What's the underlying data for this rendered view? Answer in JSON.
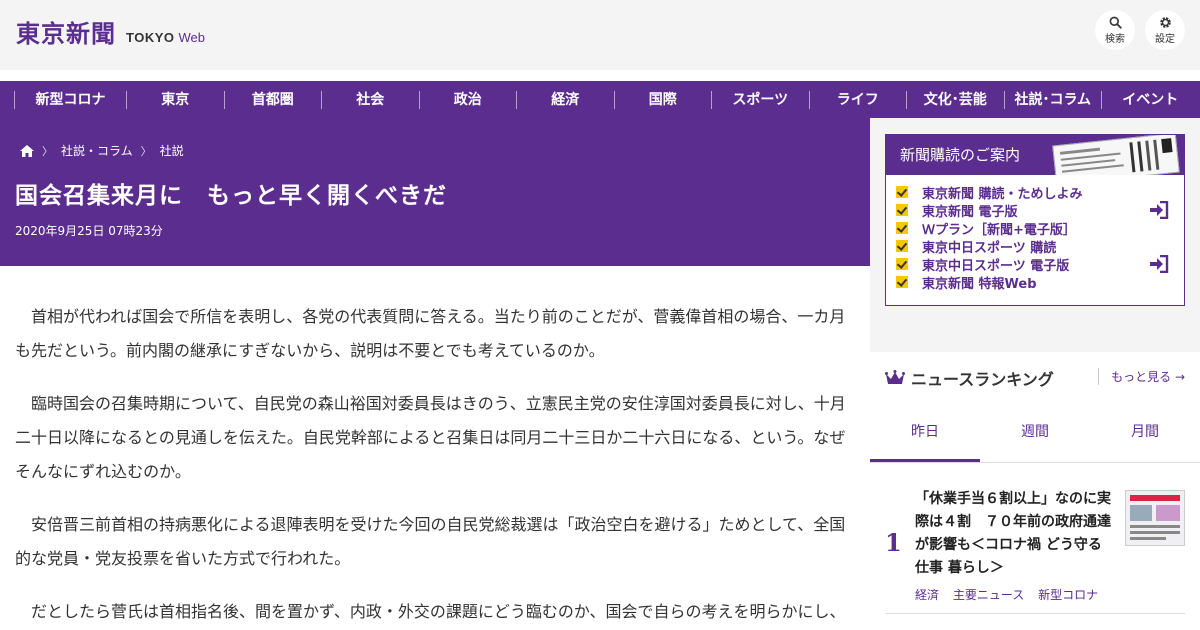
{
  "header": {
    "logo_jp": "東京新聞",
    "logo_en": "TOKYO",
    "logo_web": "Web",
    "search_label": "検索",
    "settings_label": "設定"
  },
  "nav": {
    "items": [
      "新型コロナ",
      "東京",
      "首都圏",
      "社会",
      "政治",
      "経済",
      "国際",
      "スポーツ",
      "ライフ",
      "文化･芸能",
      "社説･コラム",
      "イベント"
    ]
  },
  "article": {
    "breadcrumbs": [
      "社説・コラム",
      "社説"
    ],
    "title": "国会召集来月に　もっと早く開くべきだ",
    "date": "2020年9月25日 07時23分",
    "paragraphs": [
      "首相が代われば国会で所信を表明し、各党の代表質問に答える。当たり前のことだが、菅義偉首相の場合、一カ月も先だという。前内閣の継承にすぎないから、説明は不要とでも考えているのか。",
      "臨時国会の召集時期について、自民党の森山裕国対委員長はきのう、立憲民主党の安住淳国対委員長に対し、十月二十日以降になるとの見通しを伝えた。自民党幹部によると召集日は同月二十三日か二十六日になる、という。なぜそんなにずれ込むのか。",
      "安倍晋三前首相の持病悪化による退陣表明を受けた今回の自民党総裁選は「政治空白を避ける」ためとして、全国的な党員・党友投票を省いた方式で行われた。",
      "だとしたら菅氏は首相指名後、間を置かず、内政・外交の課題にどう臨むのか、国会で自らの考えを明らかにし、"
    ]
  },
  "promo": {
    "title": "新聞購読のご案内",
    "items": [
      {
        "label": "東京新聞 購読・ためしよみ",
        "login": false
      },
      {
        "label": "東京新聞 電子版",
        "login": true
      },
      {
        "label": "Ｗプラン［新聞+電子版］",
        "login": false
      },
      {
        "label": "東京中日スポーツ 購読",
        "login": false
      },
      {
        "label": "東京中日スポーツ 電子版",
        "login": true
      },
      {
        "label": "東京新聞 特報Web",
        "login": false
      }
    ]
  },
  "ranking": {
    "title": "ニュースランキング",
    "more": "もっと見る",
    "tabs": [
      "昨日",
      "週間",
      "月間"
    ],
    "active_tab": 0,
    "items": [
      {
        "rank": "1",
        "text": "「休業手当６割以上」なのに実際は４割　７０年前の政府通達が影響も＜コロナ禍 どう守る 仕事 暮らし＞",
        "tags": [
          "経済",
          "主要ニュース",
          "新型コロナ"
        ]
      }
    ]
  },
  "colors": {
    "brand_purple": "#5b2d8e",
    "check_yellow": "#f5c800",
    "panel_gray": "#f4f4f4"
  }
}
